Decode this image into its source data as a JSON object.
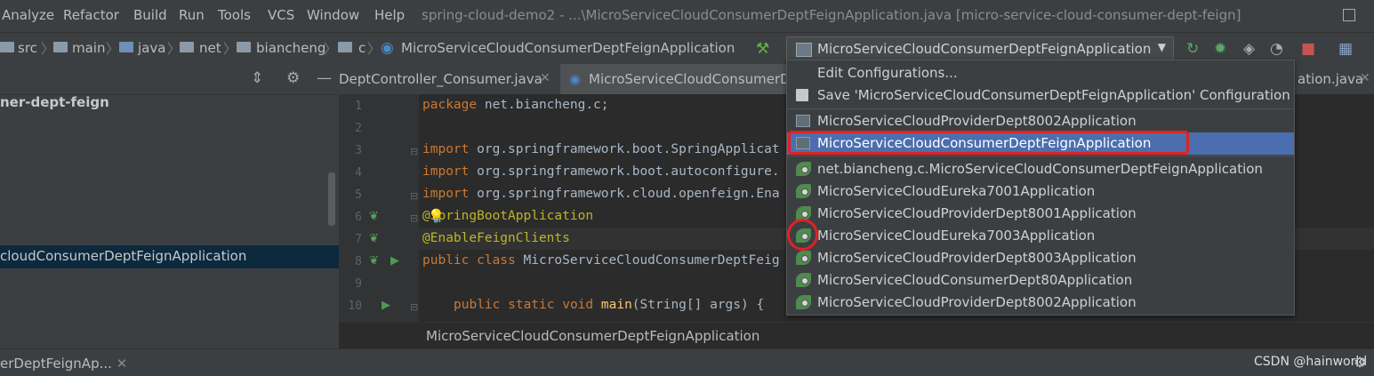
{
  "menubar": {
    "items": [
      "Analyze",
      "Refactor",
      "Build",
      "Run",
      "Tools",
      "VCS",
      "Window",
      "Help"
    ],
    "window_title": "spring-cloud-demo2 - ...\\MicroServiceCloudConsumerDeptFeignApplication.java [micro-service-cloud-consumer-dept-feign]"
  },
  "navbar": {
    "crumbs": [
      "src",
      "main",
      "java",
      "net",
      "biancheng",
      "c",
      "MicroServiceCloudConsumerDeptFeignApplication"
    ],
    "run_config": "MicroServiceCloudConsumerDeptFeignApplication"
  },
  "project_panel": {
    "root_label": "ner-dept-feign",
    "selected_label": "cloudConsumerDeptFeignApplication"
  },
  "tabs": [
    {
      "label": "DeptController_Consumer.java"
    },
    {
      "label": "MicroServiceCloudConsumerD"
    },
    {
      "label": "ation.java"
    }
  ],
  "editor": {
    "line_numbers": [
      "1",
      "2",
      "3",
      "4",
      "5",
      "6",
      "7",
      "8",
      "9",
      "10"
    ],
    "lines": {
      "l1": {
        "kw": "package",
        "rest": " net.biancheng.c;"
      },
      "l3": {
        "kw": "import",
        "rest": " org.springframework.boot.SpringApplicat"
      },
      "l4": {
        "kw": "import",
        "rest": " org.springframework.boot.autoconfigure."
      },
      "l5": {
        "kw": "import",
        "rest": " org.springframework.cloud.openfeign.Ena"
      },
      "l6": {
        "an": "@SpringBootApplication"
      },
      "l7": {
        "an": "@EnableFeignClients"
      },
      "l8": {
        "kw": "public class",
        "rest": " MicroServiceCloudConsumerDeptFeig"
      },
      "l10": {
        "kw": "public static void",
        "fn": "main",
        "rest": "(String[] args) {"
      }
    },
    "breadcrumb": "MicroServiceCloudConsumerDeptFeignApplication"
  },
  "dropdown": {
    "edit_configurations": "Edit Configurations...",
    "save_configuration": "Save 'MicroServiceCloudConsumerDeptFeignApplication' Configuration",
    "items": [
      "MicroServiceCloudProviderDept8002Application",
      "MicroServiceCloudConsumerDeptFeignApplication",
      "net.biancheng.c.MicroServiceCloudConsumerDeptFeignApplication",
      "MicroServiceCloudEureka7001Application",
      "MicroServiceCloudProviderDept8001Application",
      "MicroServiceCloudEureka7003Application",
      "MicroServiceCloudProviderDept8003Application",
      "MicroServiceCloudConsumerDept80Application",
      "MicroServiceCloudProviderDept8002Application"
    ]
  },
  "statusbar": {
    "tab_label": "erDeptFeignAp...",
    "watermark": "CSDN @hainworld"
  },
  "colors": {
    "accent": "#4b6eaf",
    "highlight_red": "#e02222",
    "background": "#2b2b2b"
  }
}
